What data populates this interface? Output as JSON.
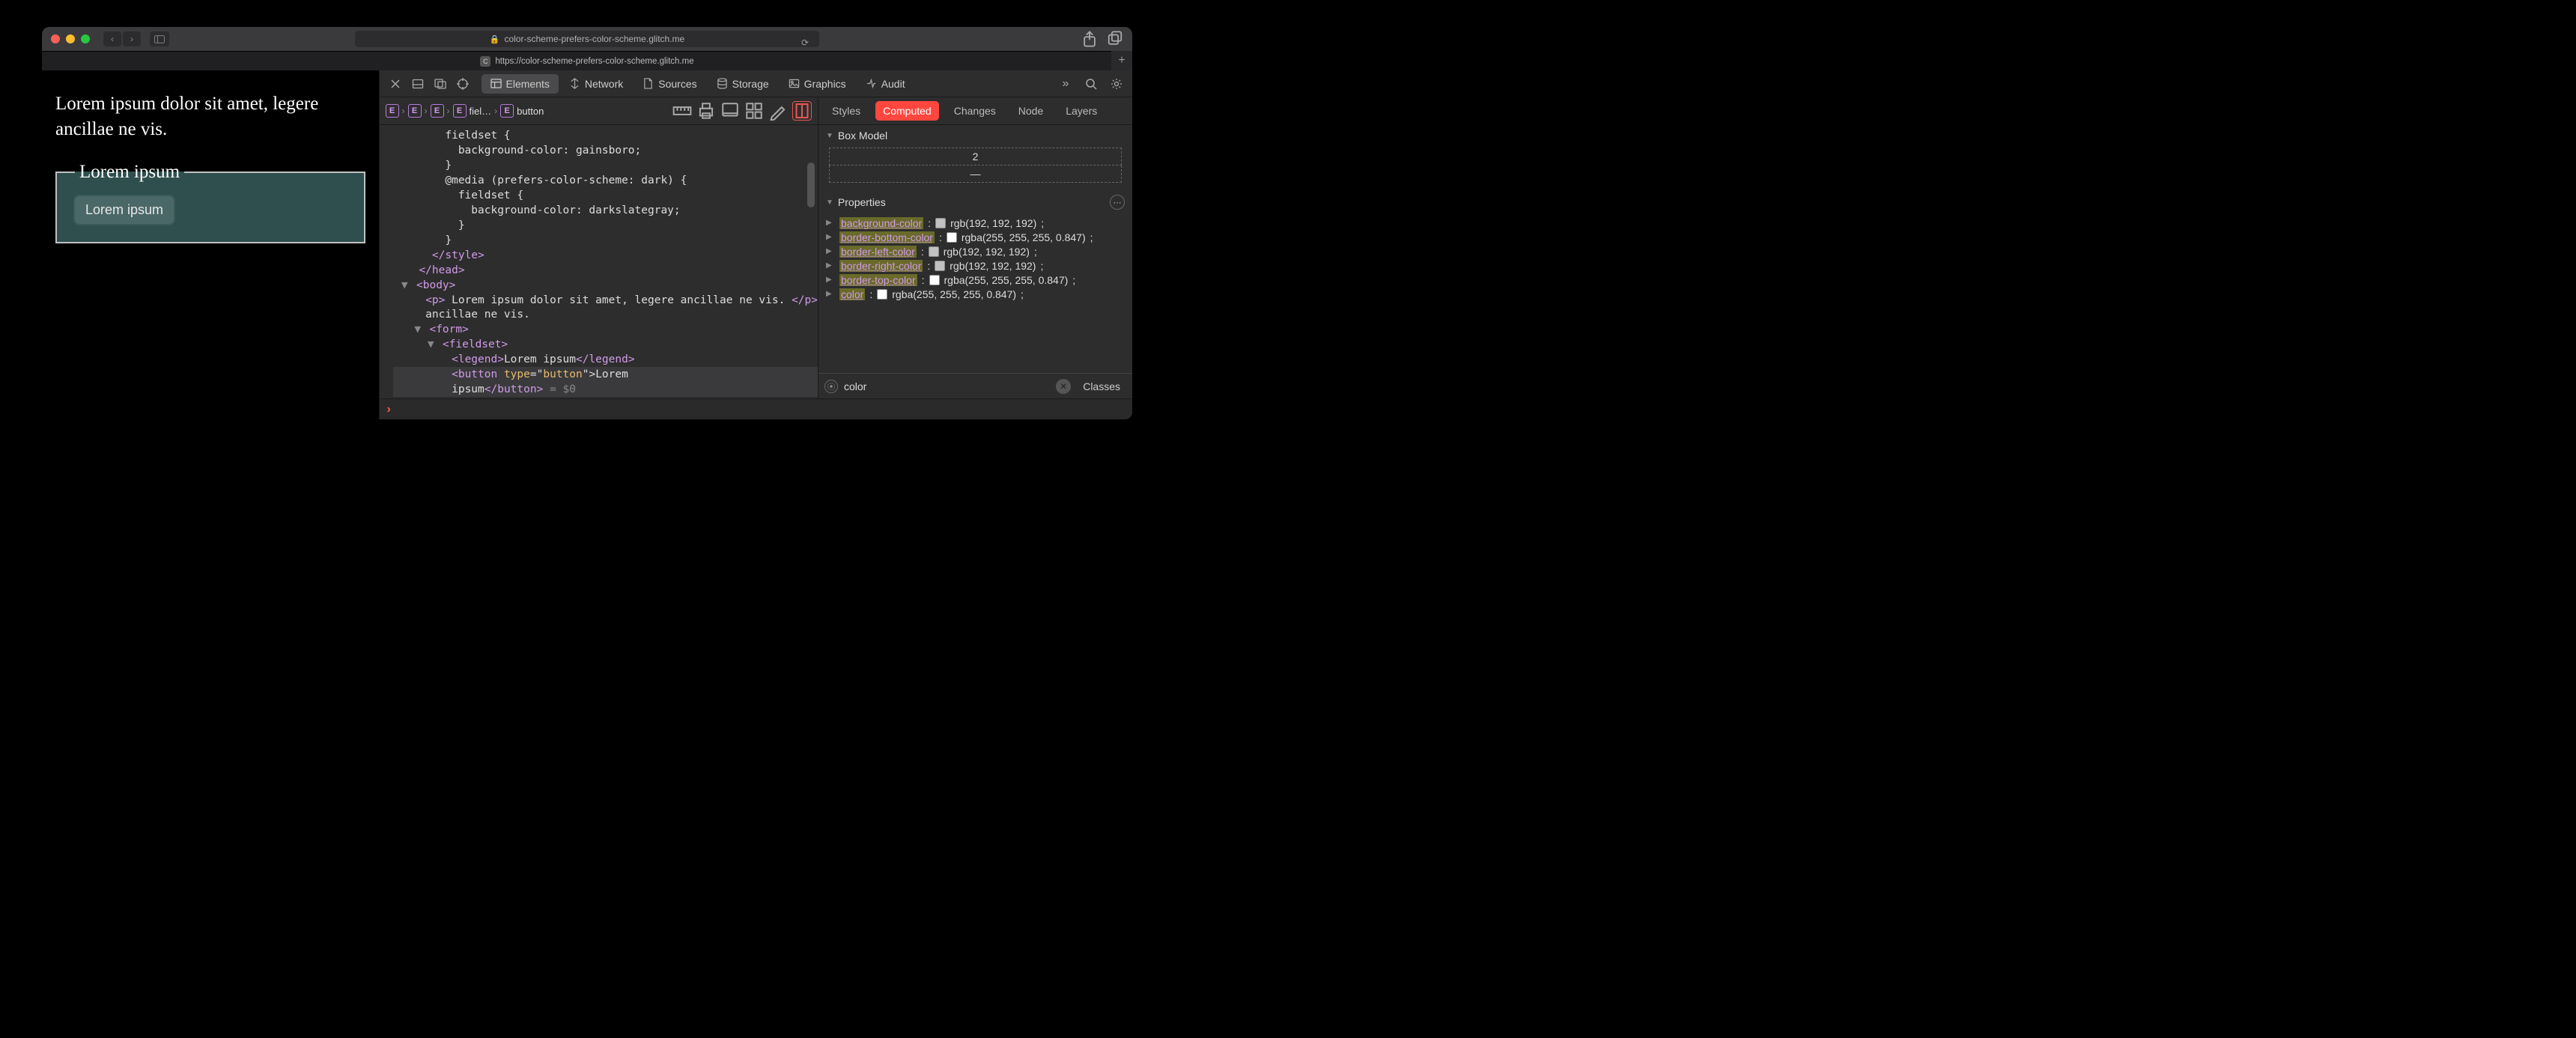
{
  "titlebar": {
    "url_display": "color-scheme-prefers-color-scheme.glitch.me"
  },
  "tab": {
    "label": "https://color-scheme-prefers-color-scheme.glitch.me",
    "favicon_letter": "C"
  },
  "page": {
    "paragraph": "Lorem ipsum dolor sit amet, legere ancillae ne vis.",
    "legend": "Lorem ipsum",
    "button_label": "Lorem ipsum"
  },
  "devtools": {
    "tabs": [
      "Elements",
      "Network",
      "Sources",
      "Storage",
      "Graphics",
      "Audit"
    ],
    "active_tab": "Elements",
    "breadcrumb": [
      {
        "badge": "E",
        "label": ""
      },
      {
        "badge": "E",
        "label": ""
      },
      {
        "badge": "E",
        "label": ""
      },
      {
        "badge": "E",
        "label": "fiel…"
      },
      {
        "badge": "E",
        "label": "button"
      }
    ],
    "code": {
      "l1": "        fieldset {",
      "l2": "          background-color: gainsboro;",
      "l3": "        }",
      "l4": "        @media (prefers-color-scheme: dark) {",
      "l5": "          fieldset {",
      "l6": "            background-color: darkslategray;",
      "l7": "          }",
      "l8": "        }",
      "close_style": "</style>",
      "close_head": "</head>",
      "open_body": "<body>",
      "p_open": "<p>",
      "p_text": " Lorem ipsum dolor sit amet, legere ancillae ne vis. ",
      "p_close": "</p>",
      "open_form": "<form>",
      "open_fieldset": "<fieldset>",
      "legend_open": "<legend>",
      "legend_text": "Lorem ipsum",
      "legend_close": "</legend>",
      "button_open": "<button ",
      "button_attr_name": "type",
      "button_attr_eq": "=\"",
      "button_attr_val": "button",
      "button_attr_close": "\">",
      "button_text1": "Lorem ",
      "button_text2": "ipsum",
      "button_close": "</button>",
      "selected_suffix": " = $0"
    }
  },
  "side": {
    "tabs": [
      "Styles",
      "Computed",
      "Changes",
      "Node",
      "Layers"
    ],
    "active": "Computed",
    "boxmodel_label": "Box Model",
    "bm_top": "2",
    "bm_bottom": "—",
    "properties_label": "Properties",
    "props": [
      {
        "name": "background-color",
        "swatch": "#c0c0c0",
        "value": "rgb(192, 192, 192)"
      },
      {
        "name": "border-bottom-color",
        "swatch": "#ffffff",
        "value": "rgba(255, 255, 255, 0.847)"
      },
      {
        "name": "border-left-color",
        "swatch": "#c0c0c0",
        "value": "rgb(192, 192, 192)"
      },
      {
        "name": "border-right-color",
        "swatch": "#c0c0c0",
        "value": "rgb(192, 192, 192)"
      },
      {
        "name": "border-top-color",
        "swatch": "#ffffff",
        "value": "rgba(255, 255, 255, 0.847)"
      },
      {
        "name": "color",
        "swatch": "#ffffff",
        "value": "rgba(255, 255, 255, 0.847)"
      }
    ],
    "filter_value": "color",
    "classes_label": "Classes"
  }
}
